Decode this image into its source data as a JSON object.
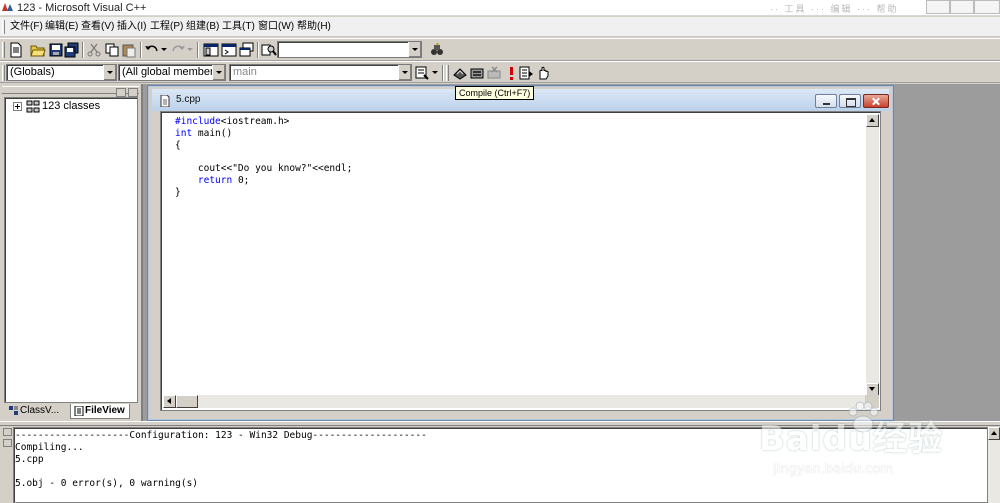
{
  "window": {
    "title": "123 - Microsoft Visual C++",
    "ghost": "·· 工具  ···  编辑  ··· 帮助"
  },
  "menubar": {
    "items": [
      "文件(F)",
      "编辑(E)",
      "查看(V)",
      "插入(I)",
      "工程(P)",
      "组建(B)",
      "工具(T)",
      "窗口(W)",
      "帮助(H)"
    ]
  },
  "toolbar1": {
    "find_combo_value": ""
  },
  "toolbar2": {
    "scope_combo": "(Globals)",
    "members_combo": "(All global members",
    "function_combo": "main"
  },
  "tooltip": {
    "text": "Compile (Ctrl+F7)"
  },
  "workspace": {
    "tree_root": "123 classes",
    "tabs": [
      "ClassV...",
      "FileView"
    ]
  },
  "document": {
    "title": "5.cpp",
    "code_lines": [
      {
        "pre": "",
        "kw": "#include",
        "post": "<iostream.h>"
      },
      {
        "pre": "",
        "kw": "int",
        "post": " main()"
      },
      {
        "pre": "{",
        "kw": "",
        "post": ""
      },
      {
        "pre": "",
        "kw": "",
        "post": ""
      },
      {
        "pre": "    cout<<\"Do you know?\"<<endl;",
        "kw": "",
        "post": ""
      },
      {
        "pre": "    ",
        "kw": "return",
        "post": " 0;"
      },
      {
        "pre": "}",
        "kw": "",
        "post": ""
      }
    ]
  },
  "output": {
    "lines": [
      "--------------------Configuration: 123 - Win32 Debug--------------------",
      "Compiling...",
      "5.cpp",
      "",
      "5.obj - 0 error(s), 0 warning(s)"
    ]
  },
  "watermark": {
    "brand": "Baidu经验",
    "url": "jingyan.baidu.com"
  },
  "colors": {
    "keyword": "#0000ff",
    "chrome": "#d4d0c8",
    "mdi_background": "#9c9c9c",
    "tooltip_bg": "#ffffe1"
  },
  "icons": {
    "toolbar1": [
      "new-text-file-icon",
      "open-icon",
      "save-icon",
      "save-all-icon",
      "cut-icon",
      "copy-icon",
      "paste-icon",
      "undo-icon",
      "redo-icon",
      "workspace-icon",
      "output-icon",
      "window-list-icon",
      "find-in-files-icon",
      "find-icon"
    ],
    "toolbar2": [
      "compile-icon",
      "build-icon",
      "stop-build-icon",
      "execute-icon",
      "go-icon",
      "breakpoint-icon"
    ]
  }
}
